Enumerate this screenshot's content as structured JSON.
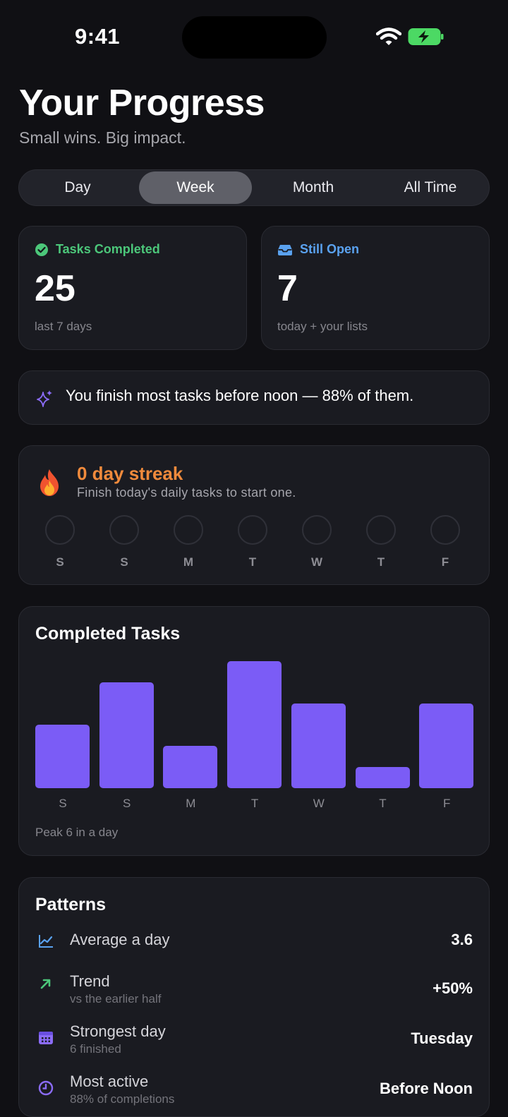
{
  "status": {
    "time": "9:41"
  },
  "header": {
    "title": "Your Progress",
    "subtitle": "Small wins. Big impact."
  },
  "tabs": [
    {
      "label": "Day"
    },
    {
      "label": "Week",
      "active": true
    },
    {
      "label": "Month"
    },
    {
      "label": "All Time"
    }
  ],
  "stats": {
    "completed": {
      "label": "Tasks Completed",
      "value": "25",
      "note": "last 7 days",
      "icon": "check-circle-icon",
      "color": "#4cc77a"
    },
    "open": {
      "label": "Still Open",
      "value": "7",
      "note": "today + your lists",
      "icon": "inbox-icon",
      "color": "#5aa2f0"
    }
  },
  "insight": {
    "text": "You finish most tasks before noon — 88% of them.",
    "icon": "sparkles-icon"
  },
  "streak": {
    "title": "0 day streak",
    "subtitle": "Finish today's daily tasks to start one.",
    "icon": "fire-icon",
    "days": [
      "S",
      "S",
      "M",
      "T",
      "W",
      "T",
      "F"
    ]
  },
  "chart_data": {
    "type": "bar",
    "title": "Completed Tasks",
    "categories": [
      "S",
      "S",
      "M",
      "T",
      "W",
      "T",
      "F"
    ],
    "values": [
      3,
      5,
      2,
      6,
      4,
      1,
      4
    ],
    "ylim": [
      0,
      6
    ],
    "color": "#7b5cf6",
    "footer": "Peak 6 in a day"
  },
  "patterns": {
    "title": "Patterns",
    "rows": [
      {
        "label": "Average a day",
        "sub": "",
        "value": "3.6",
        "icon": "line-chart-icon"
      },
      {
        "label": "Trend",
        "sub": "vs the earlier half",
        "value": "+50%",
        "icon": "arrow-up-right-icon"
      },
      {
        "label": "Strongest day",
        "sub": "6 finished",
        "value": "Tuesday",
        "icon": "calendar-icon"
      },
      {
        "label": "Most active",
        "sub": "88% of completions",
        "value": "Before Noon",
        "icon": "clock-icon"
      }
    ]
  }
}
